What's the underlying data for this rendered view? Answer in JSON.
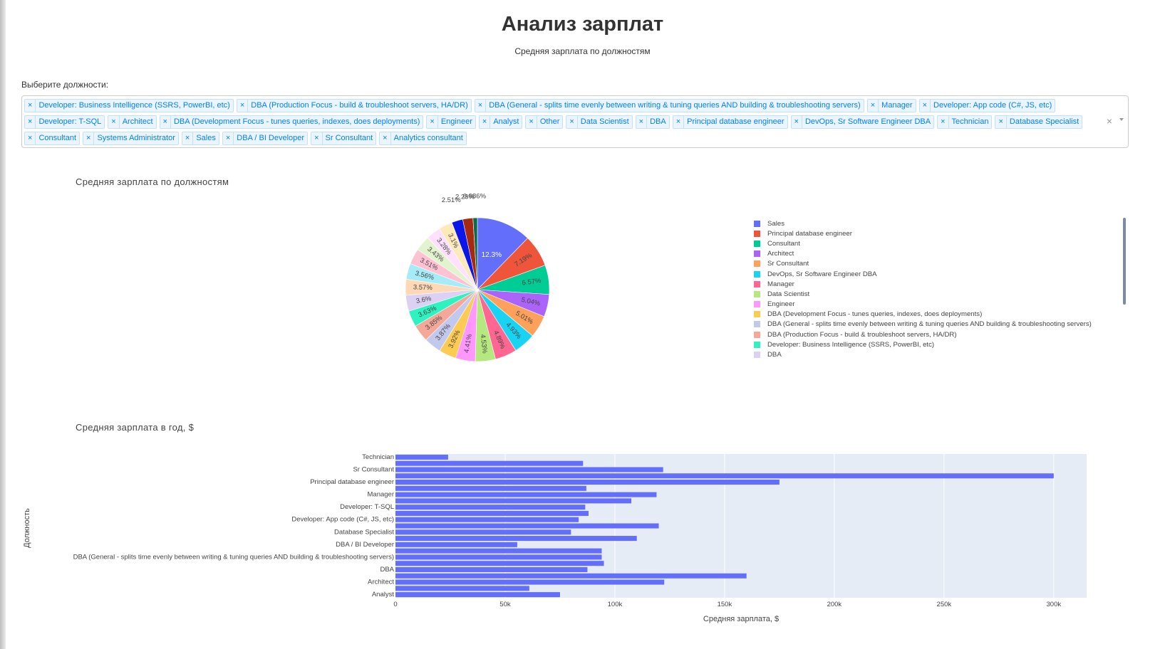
{
  "header": {
    "title": "Анализ зарплат",
    "subtitle": "Средняя зарплата по должностям"
  },
  "selector": {
    "label": "Выберите должности:",
    "remove_glyph": "×",
    "clear_glyph": "×",
    "chips": [
      "Developer: Business Intelligence (SSRS, PowerBI, etc)",
      "DBA (Production Focus - build & troubleshoot servers, HA/DR)",
      "DBA (General - splits time evenly between writing & tuning queries AND building & troubleshooting servers)",
      "Manager",
      "Developer: App code (C#, JS, etc)",
      "Developer: T-SQL",
      "Architect",
      "DBA (Development Focus - tunes queries, indexes, does deployments)",
      "Engineer",
      "Analyst",
      "Other",
      "Data Scientist",
      "DBA",
      "Principal database engineer",
      "DevOps, Sr Software Engineer DBA",
      "Technician",
      "Database Specialist",
      "Consultant",
      "Systems Administrator",
      "Sales",
      "DBA / BI Developer",
      "Sr Consultant",
      "Analytics consultant"
    ]
  },
  "pie_title": "Средняя зарплата по должностям",
  "bar_title": "Средняя зарплата в год, $",
  "chart_data": [
    {
      "type": "pie",
      "title": "Средняя зарплата по должностям",
      "legend_position": "right",
      "slices": [
        {
          "label": "Sales",
          "value": 12.3,
          "text": "12.3%",
          "color": "#636efa"
        },
        {
          "label": "Principal database engineer",
          "value": 7.19,
          "text": "7.19%",
          "color": "#ef553b"
        },
        {
          "label": "Consultant",
          "value": 6.57,
          "text": "6.57%",
          "color": "#00cc96"
        },
        {
          "label": "Architect",
          "value": 5.04,
          "text": "5.04%",
          "color": "#ab63fa"
        },
        {
          "label": "Sr Consultant",
          "value": 5.01,
          "text": "5.01%",
          "color": "#ffa15a"
        },
        {
          "label": "DevOps, Sr Software Engineer DBA",
          "value": 4.93,
          "text": "4.93%",
          "color": "#19d3f3"
        },
        {
          "label": "Manager",
          "value": 4.89,
          "text": "4.89%",
          "color": "#ff6692"
        },
        {
          "label": "Data Scientist",
          "value": 4.53,
          "text": "4.53%",
          "color": "#b6e880"
        },
        {
          "label": "Engineer",
          "value": 4.41,
          "text": "4.41%",
          "color": "#ff97ff"
        },
        {
          "label": "DBA (Development Focus - tunes queries, indexes, does deployments)",
          "value": 3.92,
          "text": "3.92%",
          "color": "#fecb52"
        },
        {
          "label": "DBA (General - splits time evenly between writing & tuning queries AND building & troubleshooting servers)",
          "value": 3.87,
          "text": "3.87%",
          "color": "#c3c8ed"
        },
        {
          "label": "DBA (Production Focus - build & troubleshoot servers, HA/DR)",
          "value": 3.85,
          "text": "3.85%",
          "color": "#f4a89a"
        },
        {
          "label": "Developer: Business Intelligence (SSRS, PowerBI, etc)",
          "value": 3.63,
          "text": "3.63%",
          "color": "#2ef2c0"
        },
        {
          "label": "DBA",
          "value": 3.6,
          "text": "3.6%",
          "color": "#dcd0f5"
        },
        {
          "label": "",
          "value": 3.57,
          "text": "3.57%",
          "color": "#ffd9b5"
        },
        {
          "label": "",
          "value": 3.56,
          "text": "3.56%",
          "color": "#a5ecf8"
        },
        {
          "label": "",
          "value": 3.51,
          "text": "3.51%",
          "color": "#ffc2d3"
        },
        {
          "label": "",
          "value": 3.43,
          "text": "3.43%",
          "color": "#e1f4cd"
        },
        {
          "label": "",
          "value": 3.28,
          "text": "3.28%",
          "color": "#ffe0ff"
        },
        {
          "label": "",
          "value": 3.1,
          "text": "3.1%",
          "color": "#ffe9bb"
        },
        {
          "label": "",
          "value": 2.51,
          "text": "2.51%",
          "color": "#0a17e6"
        },
        {
          "label": "",
          "value": 2.29,
          "text": "2.29%",
          "color": "#a62a12"
        },
        {
          "label": "",
          "value": 0.986,
          "text": "0.986%",
          "color": "#0c6b4a"
        }
      ]
    },
    {
      "type": "bar",
      "orientation": "horizontal",
      "xlabel": "Средняя зарплата, $",
      "ylabel": "Должность",
      "xlim": [
        0,
        315000
      ],
      "x_ticks": [
        0,
        50000,
        100000,
        150000,
        200000,
        250000,
        300000
      ],
      "x_tick_labels": [
        "0",
        "50k",
        "100k",
        "150k",
        "200k",
        "250k",
        "300k"
      ],
      "bar_color": "#636efa",
      "plot_bg": "#e5ecf6",
      "categories_bottom_to_top": [
        "Analyst",
        "",
        "Architect",
        "",
        "DBA",
        "",
        "DBA (General - splits time evenly between writing & tuning queries AND building & troubleshooting servers)",
        "",
        "DBA / BI Developer",
        "",
        "Database Specialist",
        "",
        "Developer: App code (C#, JS, etc)",
        "",
        "Developer: T-SQL",
        "",
        "Manager",
        "",
        "Principal database engineer",
        "",
        "Sr Consultant",
        "",
        "Technician"
      ],
      "values_bottom_to_top": [
        75000,
        61000,
        122500,
        160000,
        87500,
        95000,
        94000,
        94000,
        55500,
        110000,
        80000,
        120000,
        83500,
        88000,
        86500,
        107500,
        119000,
        87000,
        175000,
        300000,
        122000,
        85500,
        24000
      ]
    }
  ]
}
